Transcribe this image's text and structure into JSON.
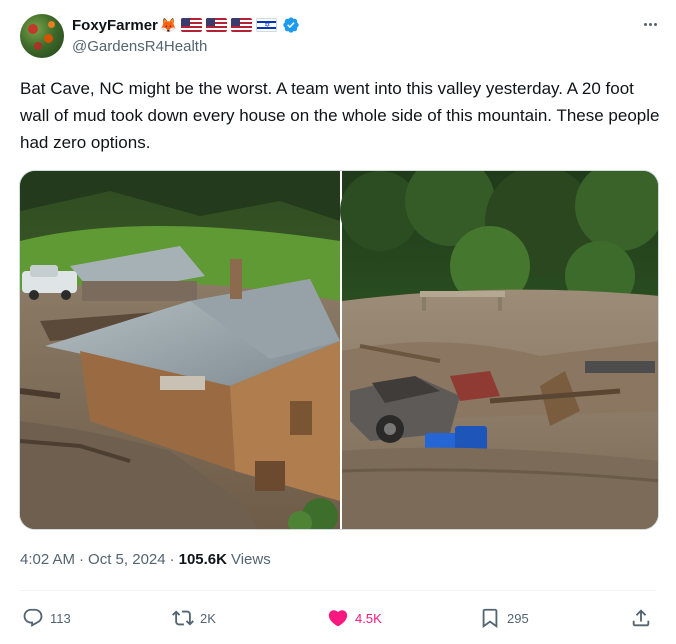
{
  "author": {
    "display_name": "FoxyFarmer",
    "handle": "@GardensR4Health",
    "emoji": "🦊",
    "flags": [
      "us",
      "us",
      "us",
      "il"
    ]
  },
  "tweet": {
    "text": "Bat Cave, NC might be the worst. A team went into this valley yesterday. A 20 foot wall of mud took down every house on the whole side of this mountain. These people had zero options."
  },
  "meta": {
    "time": "4:02 AM",
    "separator": "·",
    "date": "Oct 5, 2024",
    "views_count": "105.6K",
    "views_label": "Views"
  },
  "actions": {
    "reply_count": "113",
    "repost_count": "2K",
    "like_count": "4.5K",
    "bookmark_count": "295"
  },
  "colors": {
    "verified": "#1d9bf0",
    "like": "#f91880",
    "secondary_text": "#536471"
  },
  "icons": [
    "more-icon",
    "verified-icon",
    "reply-icon",
    "repost-icon",
    "like-icon",
    "bookmark-icon",
    "share-icon"
  ]
}
